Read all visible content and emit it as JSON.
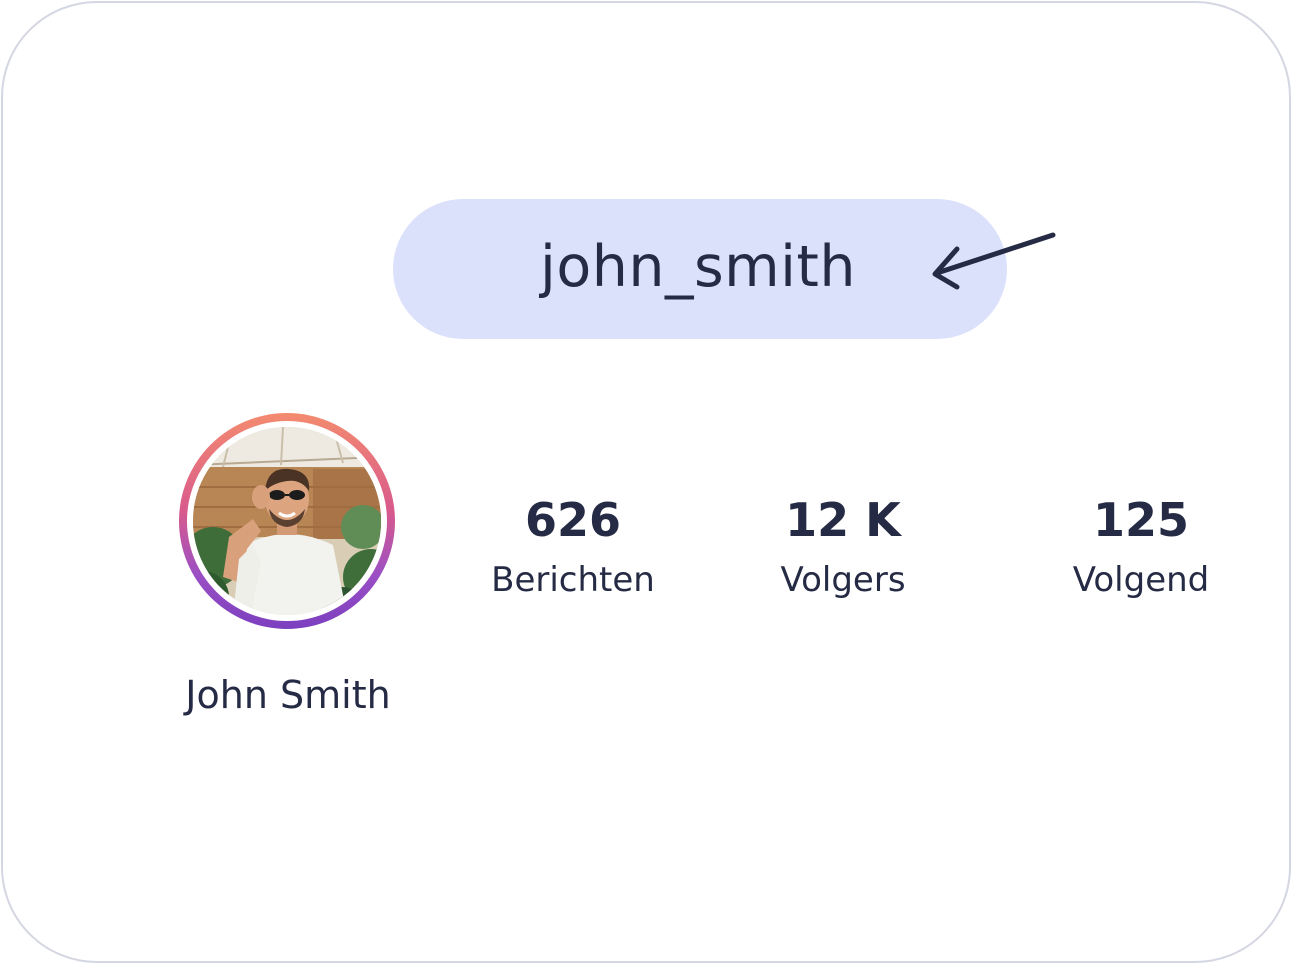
{
  "profile": {
    "username": "john_smith",
    "full_name": "John Smith",
    "avatar_icon": "profile-photo"
  },
  "stats": [
    {
      "value": "626",
      "label": "Berichten"
    },
    {
      "value": "12 K",
      "label": "Volgers"
    },
    {
      "value": "125",
      "label": "Volgend"
    }
  ],
  "colors": {
    "pill_background": "#dce1fb",
    "text": "#262b45",
    "card_border": "#d4d6e2",
    "ring_gradient": [
      "#f38b6f",
      "#d95a8c",
      "#9b4fc4",
      "#7b3fbf"
    ]
  },
  "annotation": {
    "arrow_icon": "arrow-pointing-left-icon"
  }
}
